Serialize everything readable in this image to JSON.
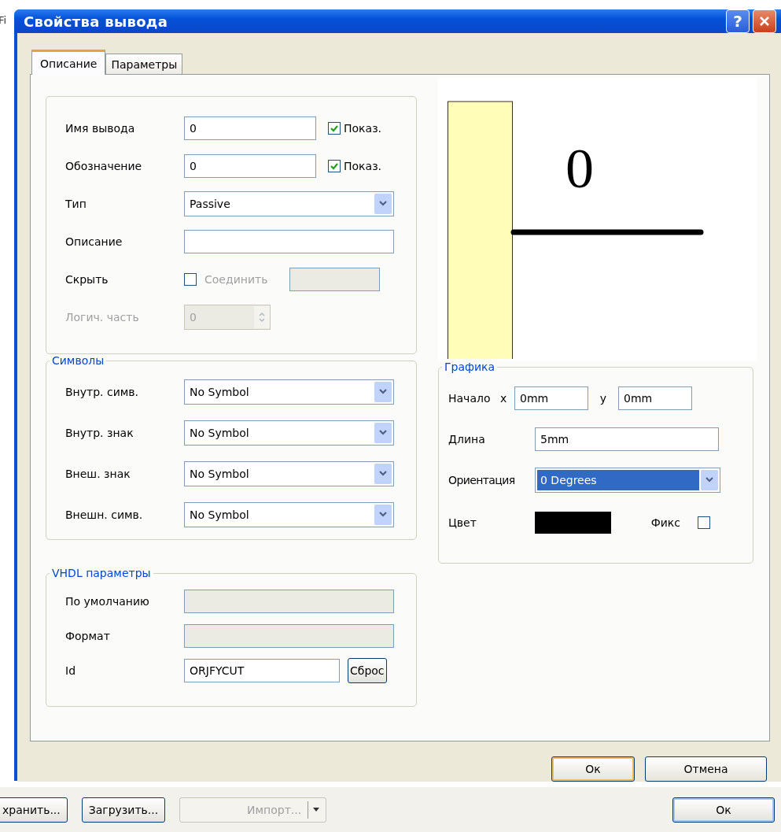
{
  "background": {
    "fragment": "Fi"
  },
  "window": {
    "title": "Свойства вывода",
    "help": "?"
  },
  "tabs": [
    {
      "label": "Описание",
      "selected": true
    },
    {
      "label": "Параметры",
      "selected": false
    }
  ],
  "general": {
    "rows": [
      {
        "kind": "text",
        "label": "Имя вывода",
        "value": "0",
        "show": {
          "label": "Показ.",
          "checked": true
        }
      },
      {
        "kind": "text",
        "label": "Обозначение",
        "value": "0",
        "show": {
          "label": "Показ.",
          "checked": true
        }
      },
      {
        "kind": "combo",
        "label": "Тип",
        "value": "Passive"
      },
      {
        "kind": "text",
        "label": "Описание"
      },
      {
        "kind": "hide",
        "label": "Скрыть",
        "checked": false,
        "connect": {
          "label": "Соединить",
          "disabled": true
        }
      },
      {
        "kind": "spin",
        "label": "Логич. часть",
        "value": "0",
        "disabled": true
      }
    ]
  },
  "preview": {
    "pin_name": "0"
  },
  "symbols": {
    "title": "Символы",
    "rows": [
      {
        "label": "Внутр. симв.",
        "value": "No Symbol"
      },
      {
        "label": "Внутр. знак",
        "value": "No Symbol"
      },
      {
        "label": "Внеш. знак",
        "value": "No Symbol"
      },
      {
        "label": "Внешн. симв.",
        "value": "No Symbol"
      }
    ]
  },
  "graphics": {
    "title": "Графика",
    "start": {
      "label": "Начало",
      "x_label": "x",
      "x": "0mm",
      "y_label": "y",
      "y": "0mm"
    },
    "length": {
      "label": "Длина",
      "value": "5mm"
    },
    "orientation": {
      "label": "Ориентация",
      "value": "0 Degrees",
      "selected": true
    },
    "color": {
      "label": "Цвет",
      "color": "#000000"
    },
    "fixed": {
      "label": "Фикс",
      "checked": false
    }
  },
  "vhdl": {
    "title": "VHDL параметры",
    "rows": [
      {
        "kind": "disabled",
        "label": "По умолчанию"
      },
      {
        "kind": "disabled",
        "label": "Формат"
      },
      {
        "kind": "text",
        "label": "Id",
        "value": "ORJFYCUT",
        "button": "Сброс"
      }
    ]
  },
  "dialog_buttons": [
    {
      "label": "Ок",
      "default": true
    },
    {
      "label": "Отмена",
      "default": false
    }
  ],
  "toolbar": {
    "buttons": [
      {
        "label": "хранить...",
        "disabled": false,
        "kind": "plain"
      },
      {
        "label": "Загрузить...",
        "disabled": false,
        "kind": "plain"
      },
      {
        "label": "Импорт...",
        "disabled": true,
        "kind": "split"
      }
    ],
    "ok": "Ок"
  }
}
